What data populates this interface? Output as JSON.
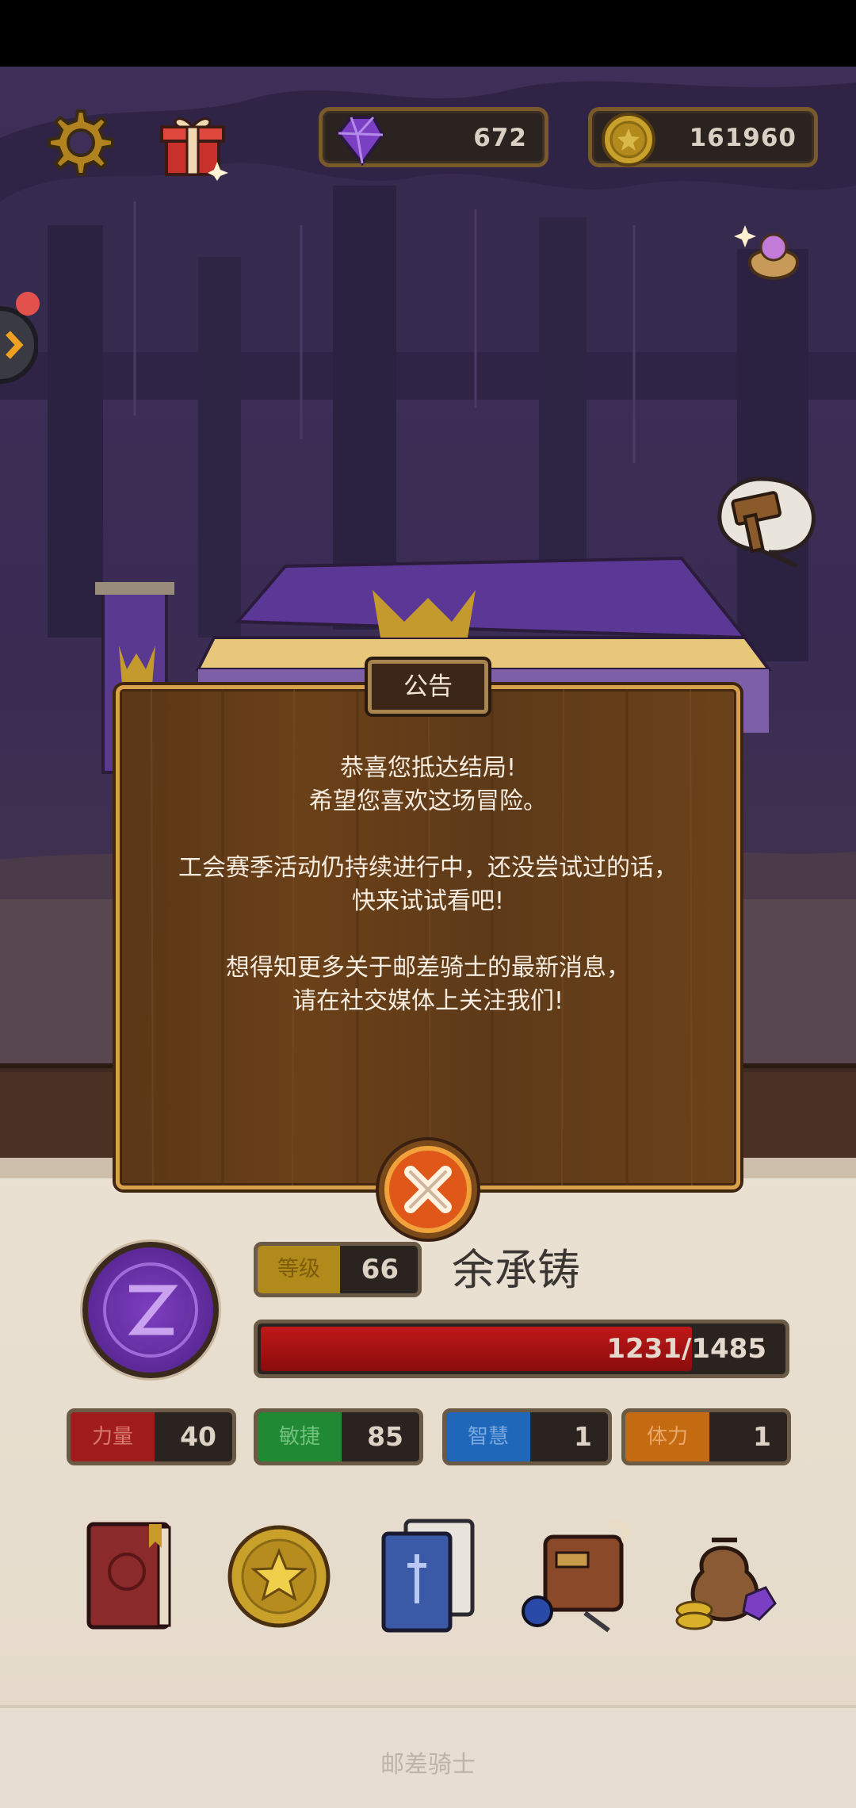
{
  "currencies": {
    "gems": "672",
    "coins": "161960"
  },
  "player": {
    "name": "余承铸",
    "level_label": "等级",
    "level": "66",
    "hp_text": "1231/1485",
    "hp_fraction": 0.829
  },
  "stats": [
    {
      "label": "力量",
      "value": "40"
    },
    {
      "label": "敏捷",
      "value": "85"
    },
    {
      "label": "智慧",
      "value": "1"
    },
    {
      "label": "体力",
      "value": "1"
    }
  ],
  "notice": {
    "title": "公告",
    "para1_line1": "恭喜您抵达结局!",
    "para1_line2": "希望您喜欢这场冒险。",
    "para2_line1": "工会赛季活动仍持续进行中，还没尝试过的话，",
    "para2_line2": "快来试试看吧!",
    "para3_line1": "想得知更多关于邮差骑士的最新消息，",
    "para3_line2": "请在社交媒体上关注我们!"
  },
  "footer": {
    "game_title": "邮差骑士"
  },
  "icons": [
    "gear-icon",
    "gift-icon",
    "gem-icon",
    "coin-icon",
    "chevron-right-icon",
    "bag-icon",
    "hammer-icon",
    "close-icon",
    "book-icon",
    "star-coin-icon",
    "cards-icon",
    "inventory-icon",
    "treasure-bag-icon"
  ]
}
